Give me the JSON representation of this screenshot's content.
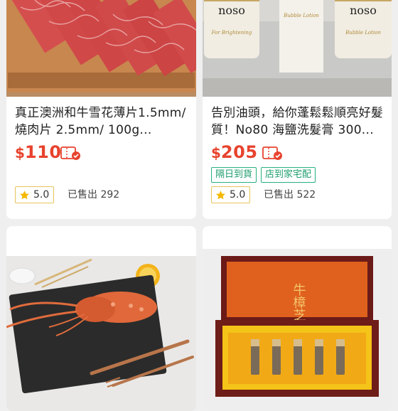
{
  "products": [
    {
      "title": "真正澳洲和牛雪花薄片1.5mm/燒肉片 2.5mm/ 100g...",
      "currency": "$",
      "price": "110",
      "tags": [],
      "rating": "5.0",
      "sold": "已售出 292"
    },
    {
      "title": "告別油頭，給你蓬鬆鬆順亮好髮質！No80 海鹽洗髮膏 300...",
      "currency": "$",
      "price": "205",
      "tags": [
        "隔日到貨",
        "店到家宅配"
      ],
      "rating": "5.0",
      "sold": "已售出 522",
      "image_text": {
        "brand": "noso",
        "label_left": "For Brightening",
        "label_right": "Bubble Lotion"
      }
    },
    {
      "image": "lobster-on-slate"
    },
    {
      "image": "vial-gift-box",
      "image_text": {
        "box_label": "牛樟芝"
      }
    }
  ],
  "colors": {
    "price": "#e8432e",
    "tag": "#29b07f",
    "rating_border": "#e8c45b",
    "background": "#efefef"
  },
  "icons": {
    "coupon": "coupon-ticket-icon",
    "rating": "star-icon"
  }
}
